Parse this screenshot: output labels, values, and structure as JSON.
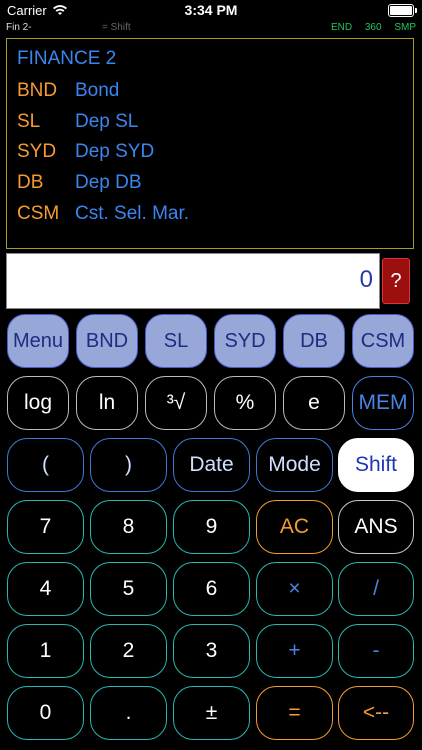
{
  "status": {
    "carrier": "Carrier",
    "time": "3:34 PM"
  },
  "info": {
    "mode": "Fin 2-",
    "shift": "=  Shift",
    "flags": [
      "END",
      "360",
      "SMP"
    ]
  },
  "menu": {
    "title": "FINANCE 2",
    "items": [
      {
        "key": "BND",
        "desc": "Bond"
      },
      {
        "key": "SL",
        "desc": "Dep SL"
      },
      {
        "key": "SYD",
        "desc": "Dep SYD"
      },
      {
        "key": "DB",
        "desc": "Dep DB"
      },
      {
        "key": "CSM",
        "desc": "Cst. Sel. Mar."
      }
    ]
  },
  "display": {
    "value": "0",
    "help": "?"
  },
  "softkeys": [
    "Menu",
    "BND",
    "SL",
    "SYD",
    "DB",
    "CSM"
  ],
  "row2": [
    "log",
    "ln",
    "³√",
    "%",
    "e",
    "MEM"
  ],
  "row3": [
    "(",
    ")",
    "Date",
    "Mode",
    "Shift"
  ],
  "keypad": [
    [
      "7",
      "8",
      "9",
      "AC",
      "ANS"
    ],
    [
      "4",
      "5",
      "6",
      "×",
      "/"
    ],
    [
      "1",
      "2",
      "3",
      "+",
      "-"
    ],
    [
      "0",
      ".",
      "±",
      "=",
      "<--"
    ]
  ]
}
